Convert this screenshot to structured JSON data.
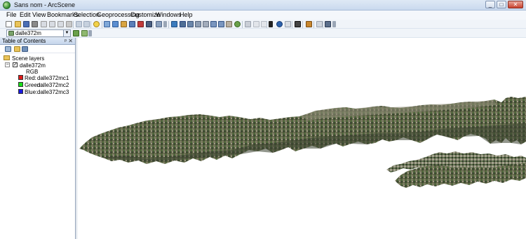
{
  "window": {
    "title": "Sans nom - ArcScene",
    "minimize": "_",
    "maximize": "□",
    "close": "✕"
  },
  "menu": [
    "File",
    "Edit",
    "View",
    "Bookmarks",
    "Selection",
    "Geoprocessing",
    "Customize",
    "Windows",
    "Help"
  ],
  "layer_selector": {
    "value": "dalle372m"
  },
  "toc": {
    "title": "Table of Contents",
    "pin": "ᵖ",
    "close": "✕",
    "group": "Scene layers",
    "layer": {
      "name": "dalle372m",
      "checked": "✓",
      "collapse": "−"
    },
    "render": "RGB",
    "bands": [
      {
        "label": "Red:",
        "value": "dalle372mc1",
        "color": "#e01818"
      },
      {
        "label": "Green:",
        "value": "dalle372mc2",
        "color": "#18e018"
      },
      {
        "label": "Blue:",
        "value": "dalle372mc3",
        "color": "#1818e0"
      }
    ]
  },
  "colors": {
    "terrain_dark": "#3f4a33",
    "terrain_mid": "#6b7552",
    "terrain_light": "#9a9a85",
    "accent": "#2f6fb0"
  }
}
